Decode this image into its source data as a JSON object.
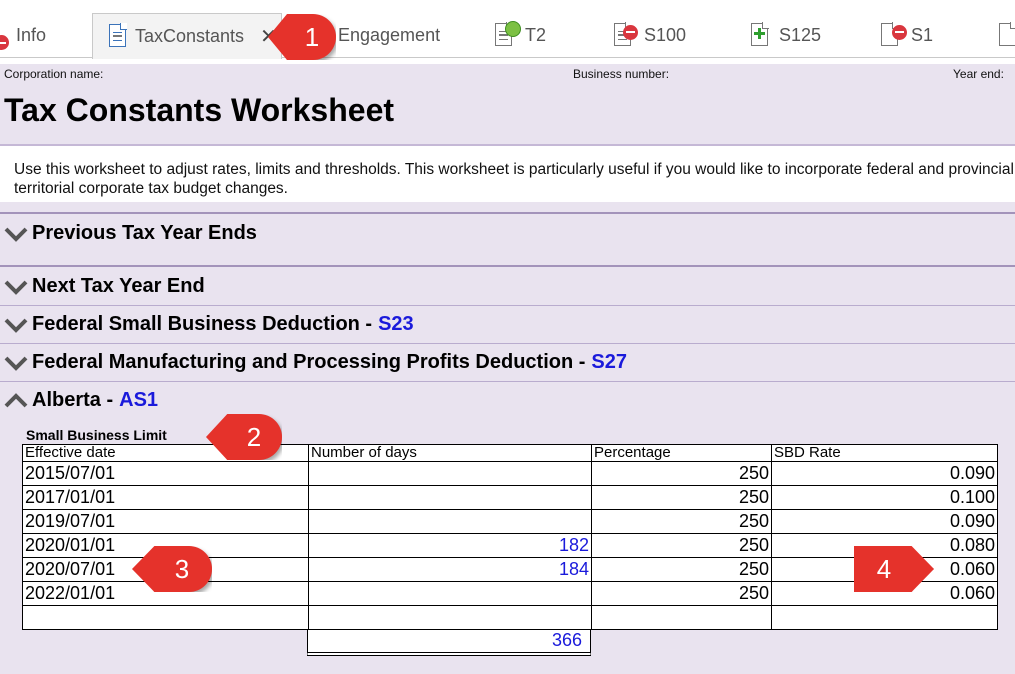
{
  "tabs": [
    {
      "label": "Info",
      "icon": "error-icon"
    },
    {
      "label": "TaxConstants",
      "icon": "document-icon",
      "active": true
    },
    {
      "label": "Engagement",
      "icon": "none"
    },
    {
      "label": "T2",
      "icon": "document-check-icon"
    },
    {
      "label": "S100",
      "icon": "document-error-icon"
    },
    {
      "label": "S125",
      "icon": "document-add-icon"
    },
    {
      "label": "S1",
      "icon": "document-error-icon"
    }
  ],
  "header": {
    "corporation_label": "Corporation name:",
    "business_number_label": "Business number:",
    "year_end_label": "Year end:"
  },
  "page_title": "Tax Constants Worksheet",
  "description": "Use this worksheet to adjust rates, limits and thresholds. This worksheet is particularly useful if you would like to incorporate federal and provincial or territorial corporate tax budget changes.",
  "sections": [
    {
      "title": "Previous Tax Year Ends",
      "ref": "",
      "expanded": false
    },
    {
      "title": "Next Tax Year End",
      "ref": "",
      "expanded": false
    },
    {
      "title": "Federal Small Business Deduction -",
      "ref": "S23",
      "expanded": false
    },
    {
      "title": "Federal Manufacturing and Processing Profits Deduction -",
      "ref": "S27",
      "expanded": false
    },
    {
      "title": "Alberta -",
      "ref": "AS1",
      "expanded": true
    }
  ],
  "sbl": {
    "title": "Small Business Limit",
    "headers": [
      "Effective date",
      "Number of days",
      "Percentage",
      "SBD Rate"
    ],
    "rows": [
      {
        "date": "2015/07/01",
        "days": "",
        "pct": "250",
        "rate": "0.090"
      },
      {
        "date": "2017/01/01",
        "days": "",
        "pct": "250",
        "rate": "0.100"
      },
      {
        "date": "2019/07/01",
        "days": "",
        "pct": "250",
        "rate": "0.090"
      },
      {
        "date": "2020/01/01",
        "days": "182",
        "pct": "250",
        "rate": "0.080"
      },
      {
        "date": "2020/07/01",
        "days": "184",
        "pct": "250",
        "rate": "0.060"
      },
      {
        "date": "2022/01/01",
        "days": "",
        "pct": "250",
        "rate": "0.060"
      },
      {
        "date": "",
        "days": "",
        "pct": "",
        "rate": ""
      }
    ],
    "total_days": "366"
  },
  "callouts": [
    "1",
    "2",
    "3",
    "4"
  ],
  "colors": {
    "callout": "#e5322b",
    "content_bg": "#e9e3ef",
    "link_blue": "#1a1adb"
  }
}
